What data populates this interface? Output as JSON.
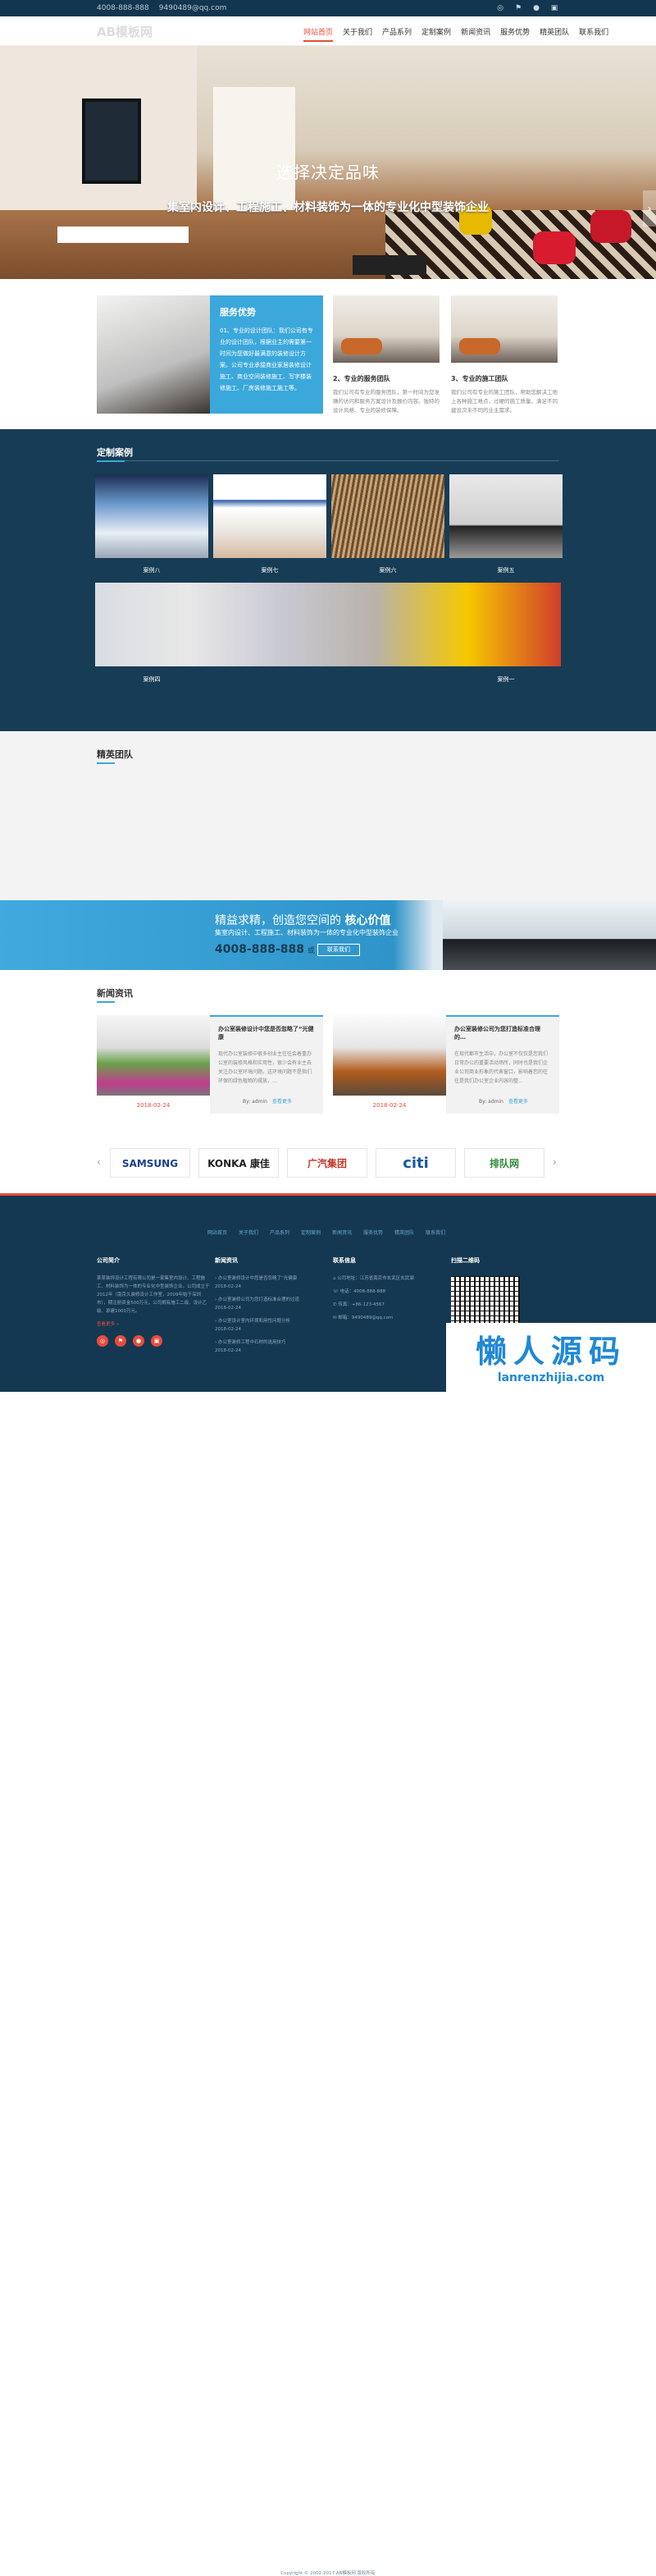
{
  "topbar": {
    "phone": "4008-888-888",
    "email": "9490489@qq.com"
  },
  "nav": {
    "logo": "AB模板网",
    "menu": [
      "网站首页",
      "关于我们",
      "产品系列",
      "定制案例",
      "新闻资讯",
      "服务优势",
      "精英团队",
      "联系我们"
    ],
    "active": 0
  },
  "hero": {
    "title": "选择决定品味",
    "subtitle": "集室内设计、工程施工、材料装饰为一体的专业化中型装饰企业",
    "next_icon": "›"
  },
  "advantage": {
    "title": "服务优势",
    "text": "01、专业的设计团队：我们公司有专业的设计团队，根据业主的需要第一时间为您做好最满意的装修设计方案。公司专业承接商业家居装修设计施工、商业空间装修施工、写字楼装修施工、厂房装修施工施工等。"
  },
  "cards": [
    {
      "title": "2、专业的服务团队",
      "text": "我们公司有专业的服务团队，第一时间为您准确的访问和服务方案设计及报价内容。独特的设计风格、专业的装修保障。"
    },
    {
      "title": "3、专业的施工团队",
      "text": "我们公司有专业的施工团队，帮助您解决工地上各种施工难点，过硬的施工质量，满足不同建设次未不同的业主需求。"
    }
  ],
  "cases": {
    "title": "定制案例",
    "items": [
      "案例八",
      "案例七",
      "案例六",
      "案例五",
      "案例四",
      "案例一"
    ]
  },
  "team": {
    "title": "精英团队"
  },
  "banner": {
    "line1": "精益求精，创造您空间的",
    "line1_bold": "核心价值",
    "line2": "集室内设计、工程施工、材料装饰为一体的专业化中型装饰企业",
    "phone": "4008-888-888",
    "or": "或",
    "button": "联系我们"
  },
  "news": {
    "title": "新闻资讯",
    "items": [
      {
        "title": "办公室装修设计中您是否忽略了“光健康",
        "text": "现代办公室装修中很多创业主往往会着重办公室的装修风格和实用性，很少会有业主去关注办公室环境问题。这环境问题不是指们环保的绿色植物的摆放，…",
        "date": "2018-02-24",
        "by": "By: admin",
        "more": "查看更多"
      },
      {
        "title": "办公室装修公司为您打造标准合理的…",
        "text": "在现代都市生活中，办公室不仅仅是您我们日常办公的重要活动场所，同时也是我们企业公司商业形象的代表窗口，影响着您的往往是我们办公室企业内容的整…",
        "date": "2018-02-24",
        "by": "By: admin",
        "more": "查看更多"
      }
    ]
  },
  "partners": [
    "SAMSUNG",
    "KONKA 康佳",
    "广汽集团",
    "citi",
    "排队网"
  ],
  "footer": {
    "links": [
      "网站首页",
      "关于我们",
      "产品系列",
      "定制案例",
      "新闻资讯",
      "服务优势",
      "精英团队",
      "联系我们"
    ],
    "about_title": "公司简介",
    "about": "某某装饰设计工程有限公司是一家集室内设计、工程施工、材料装饰为一体的专业化中型装饰企业。公司成立于2012年（南京久装修设计工作室，2009年始于深圳市），期注册资金500万元，公司拥有施工二级、设计乙级、承建1000万元。",
    "about_more": "查看更多 »",
    "news_title": "新闻资讯",
    "news": [
      [
        "办公室装修设计中您是否忽略了“光健康",
        "2018-02-24"
      ],
      [
        "办公室装修公司为您打造标准合理的过道",
        "2018-02-24"
      ],
      [
        "办公室设计室内环境和用性问题分析",
        "2018-02-24"
      ],
      [
        "办公室装修工程中石材的选用技巧",
        "2018-02-24"
      ]
    ],
    "contact_title": "联系信息",
    "contact": [
      "公司地址：江苏省南京市玄武区玄武湖",
      "电话：4008-888-888",
      "传真：+86-123-4567",
      "邮箱：9490489@qq.com"
    ],
    "qr_title": "扫描二维码",
    "copyright": "Copyright © 2002-2017 AB模板网 版权所有",
    "watermark": "懒人源码",
    "watermark_url": "lanrenzhijia.com"
  }
}
